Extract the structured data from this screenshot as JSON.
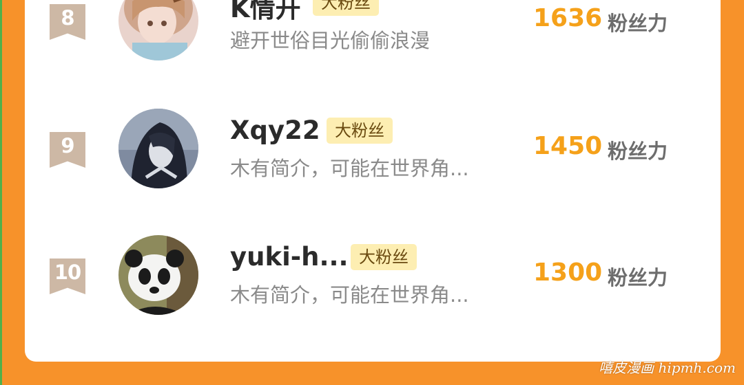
{
  "score_unit": "粉丝力",
  "watermark": "嘻皮漫画 hipmh.com",
  "rows": [
    {
      "rank": "8",
      "name": "K情开",
      "tag": "大粉丝",
      "desc": "避开世俗目光偷偷浪漫",
      "score": "1636"
    },
    {
      "rank": "9",
      "name": "Xqy22",
      "tag": "大粉丝",
      "desc": "木有简介，可能在世界角...",
      "score": "1450"
    },
    {
      "rank": "10",
      "name": "yuki-h...",
      "tag": "大粉丝",
      "desc": "木有简介，可能在世界角...",
      "score": "1300"
    }
  ]
}
